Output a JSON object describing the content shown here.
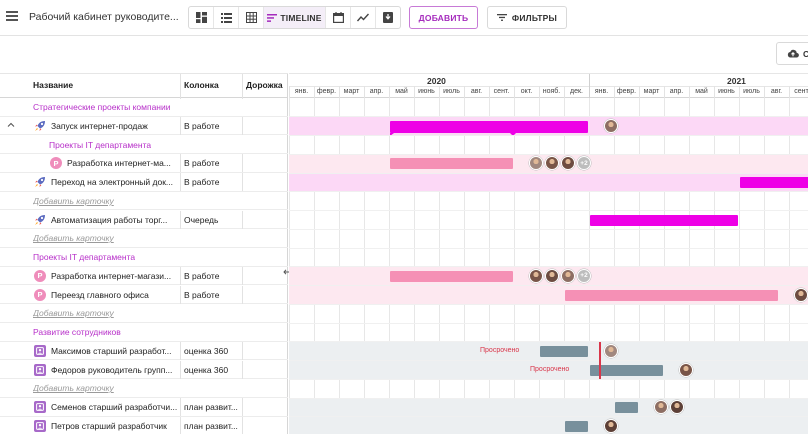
{
  "header": {
    "title": "Рабочий кабинет руководите...",
    "views": [
      {
        "icon": "board-view-icon"
      },
      {
        "icon": "list-view-icon"
      },
      {
        "icon": "table-view-icon"
      },
      {
        "icon": "timeline-view-icon",
        "label": "TIMELINE",
        "active": true
      },
      {
        "icon": "calendar-view-icon"
      },
      {
        "icon": "chart-view-icon"
      },
      {
        "icon": "archive-view-icon"
      }
    ],
    "add_label": "ДОБАВИТЬ",
    "filters_label": "ФИЛЬТРЫ",
    "cloud_label": "С"
  },
  "columns": {
    "name": "Название",
    "column": "Колонка",
    "track": "Дорожка"
  },
  "timeline": {
    "years": [
      "2020",
      "2021"
    ],
    "months": [
      "янв.",
      "февр.",
      "март",
      "апр.",
      "май",
      "июнь",
      "июль",
      "авг.",
      "сент.",
      "окт.",
      "нояб.",
      "дек.",
      "янв.",
      "февр.",
      "март",
      "апр.",
      "май",
      "июнь",
      "июль",
      "авг.",
      "сент"
    ],
    "overdue_label": "Просрочено"
  },
  "rows": [
    {
      "type": "group",
      "name": "Стратегические проекты компании"
    },
    {
      "type": "item",
      "icon": "rocket",
      "expand": true,
      "name": "Запуск интернет-продаж",
      "column": "В работе",
      "band": "#fcd8f6",
      "bar": {
        "start": 4,
        "end": 12,
        "color": "#ee00e6",
        "flag": true
      },
      "avatars": 1,
      "more": ""
    },
    {
      "type": "group",
      "indent": 1,
      "name": "Проекты IT департамента"
    },
    {
      "type": "item",
      "icon": "p",
      "indent": 1,
      "name": "Разработка интернет-ма...",
      "column": "В работе",
      "band": "#fde8f0",
      "bar": {
        "start": 4,
        "end": 9,
        "color": "#f590b5"
      },
      "avatars": 3,
      "more": "+2"
    },
    {
      "type": "item",
      "icon": "rocket",
      "name": "Переход на электронный док...",
      "column": "В работе",
      "band": "#fcd8f6",
      "bar": {
        "start": 18,
        "end": 21,
        "color": "#ee00e6"
      },
      "avatars": 0,
      "more": ""
    },
    {
      "type": "add",
      "name": "Добавить карточку"
    },
    {
      "type": "item",
      "icon": "rocket",
      "name": "Автоматизация работы торг...",
      "column": "Очередь",
      "band": "",
      "bar": {
        "start": 12,
        "end": 18,
        "color": "#ee00e6"
      },
      "avatars": 0,
      "more": ""
    },
    {
      "type": "add",
      "name": "Добавить карточку"
    },
    {
      "type": "group",
      "name": "Проекты IT департамента"
    },
    {
      "type": "item",
      "icon": "p",
      "name": "Разработка интернет-магази...",
      "column": "В работе",
      "band": "#fde8f0",
      "bar": {
        "start": 4,
        "end": 9,
        "color": "#f590b5"
      },
      "avatars": 3,
      "more": "+2"
    },
    {
      "type": "item",
      "icon": "p",
      "name": "Переезд главного офиса",
      "column": "В работе",
      "band": "#fde8f0",
      "bar": {
        "start": 11,
        "end": 19.6,
        "color": "#f590b5"
      },
      "avatars": 2,
      "more": ""
    },
    {
      "type": "add",
      "name": "Добавить карточку"
    },
    {
      "type": "group",
      "name": "Развитие сотрудников"
    },
    {
      "type": "item",
      "icon": "sq",
      "name": "Максимов старший разработ...",
      "column": "оценка 360",
      "band": "#eceff1",
      "bar": {
        "start": 10,
        "end": 12,
        "color": "#78909c"
      },
      "avatars": 1,
      "overdue": true,
      "more": ""
    },
    {
      "type": "item",
      "icon": "sq",
      "name": "Федоров руководитель групп...",
      "column": "оценка 360",
      "band": "#eceff1",
      "bar": {
        "start": 12,
        "end": 15,
        "color": "#78909c"
      },
      "avatars": 1,
      "overdue": true,
      "more": ""
    },
    {
      "type": "add",
      "name": "Добавить карточку"
    },
    {
      "type": "item",
      "icon": "sq",
      "name": "Семенов старший разработчи...",
      "column": "план развит...",
      "band": "#eceff1",
      "bar": {
        "start": 13,
        "end": 14,
        "color": "#78909c"
      },
      "avatars": 2,
      "more": ""
    },
    {
      "type": "item",
      "icon": "sq",
      "name": "Петров старший разработчик",
      "column": "план развит...",
      "band": "#eceff1",
      "bar": {
        "start": 11,
        "end": 12,
        "color": "#78909c"
      },
      "avatars": 1,
      "more": ""
    }
  ],
  "colors": {
    "accent": "#a52bbd",
    "group_text": "#b72fc9",
    "overdue": "#d9364a"
  }
}
